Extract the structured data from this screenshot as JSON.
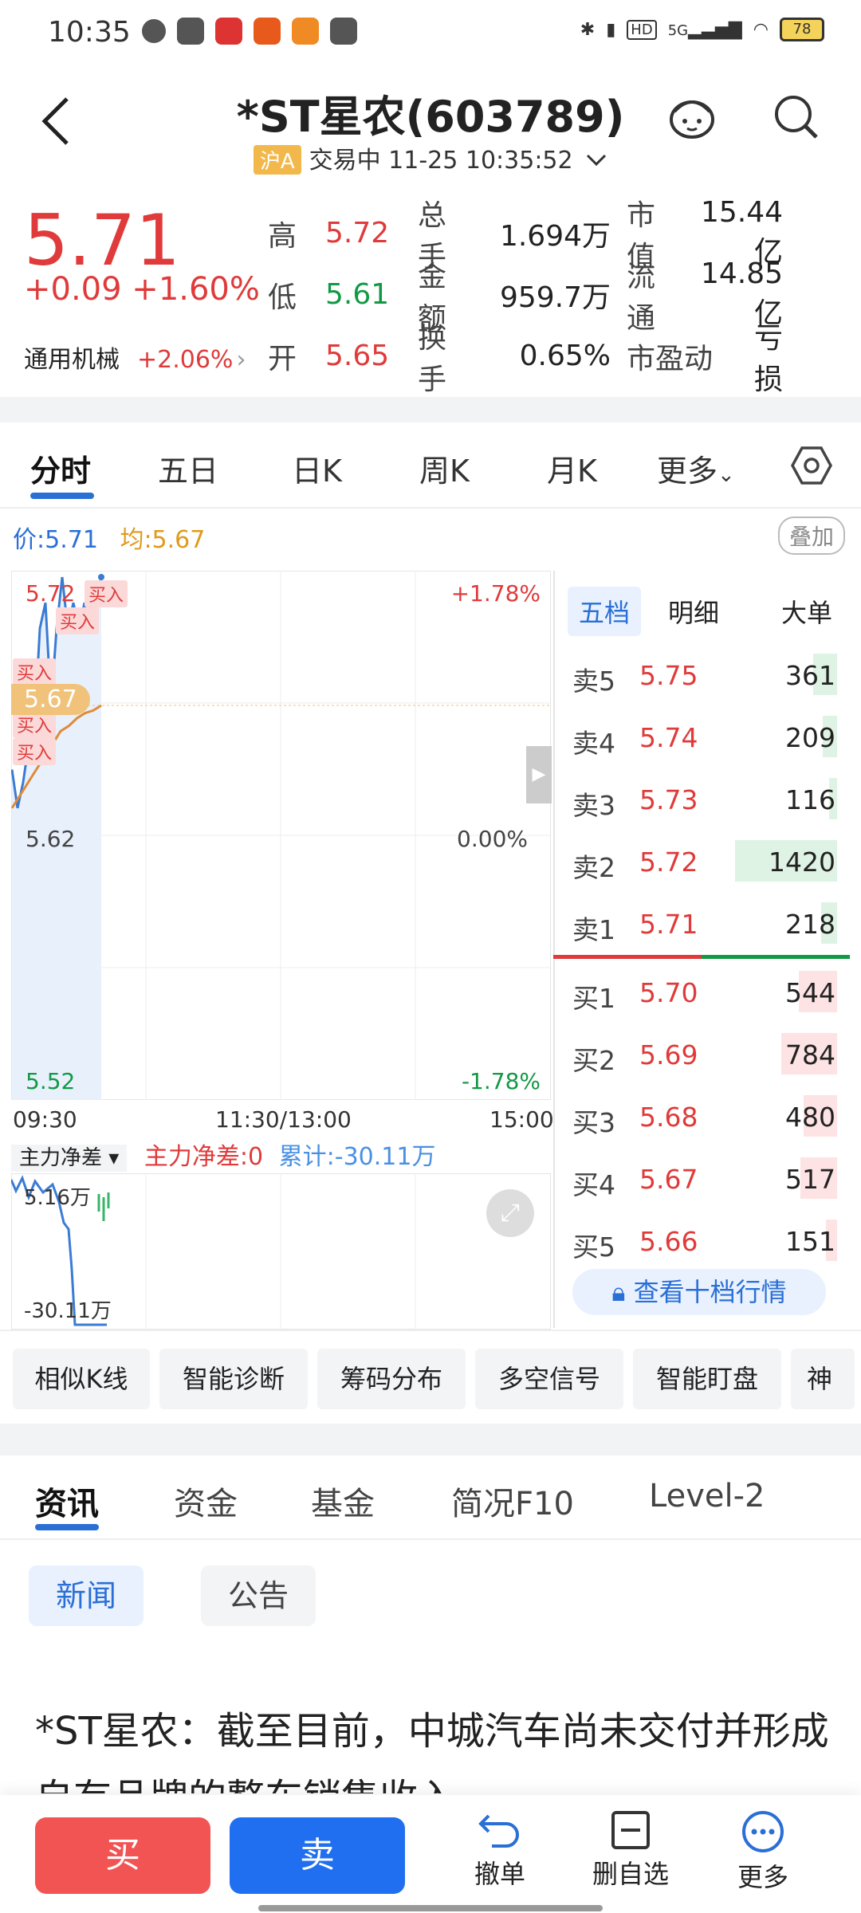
{
  "status_bar": {
    "time": "10:35",
    "network": "5G",
    "hd": "HD",
    "battery": "78"
  },
  "header": {
    "title": "*ST星农(603789)",
    "market_badge": "沪A",
    "trade_status": "交易中 11-25 10:35:52"
  },
  "quote": {
    "price": "5.71",
    "change": "+0.09",
    "change_pct": "+1.60%",
    "sector": "通用机械",
    "sector_pct": "+2.06%",
    "rows": [
      [
        {
          "label": "高",
          "value": "5.72"
        },
        {
          "label": "总手",
          "value": "1.694万"
        },
        {
          "label": "市值",
          "value": "15.44亿"
        }
      ],
      [
        {
          "label": "低",
          "value": "5.61"
        },
        {
          "label": "金额",
          "value": "959.7万"
        },
        {
          "label": "流通",
          "value": "14.85亿"
        }
      ],
      [
        {
          "label": "开",
          "value": "5.65"
        },
        {
          "label": "换手",
          "value": "0.65%"
        },
        {
          "label": "市盈动",
          "value": "亏损"
        }
      ]
    ]
  },
  "chart_tabs": [
    "分时",
    "五日",
    "日K",
    "周K",
    "月K",
    "更多"
  ],
  "intraday": {
    "price_label": "价:5.71",
    "avg_label": "均:5.67",
    "overlay": "叠加",
    "y_top": "5.72",
    "y_mid": "5.62",
    "y_bottom": "5.52",
    "pct_top": "+1.78%",
    "pct_mid": "0.00%",
    "pct_bottom": "-1.78%",
    "avg_bubble": "5.67",
    "buy_tag": "买入",
    "time_start": "09:30",
    "time_mid": "11:30/13:00",
    "time_end": "15:00"
  },
  "chart_data": {
    "type": "line",
    "ylim": [
      5.52,
      5.72
    ],
    "series": [
      {
        "values": [
          5.645,
          5.63,
          5.64,
          5.655,
          5.66,
          5.7,
          5.71,
          5.67,
          5.7,
          5.72,
          5.7,
          5.71,
          5.7,
          5.71,
          5.7,
          5.71,
          5.72
        ]
      },
      {
        "values": [
          5.63,
          5.635,
          5.64,
          5.645,
          5.65,
          5.655,
          5.66,
          5.662,
          5.665,
          5.667,
          5.668,
          5.67
        ]
      }
    ]
  },
  "orderbook": {
    "tabs": [
      "五档",
      "明细",
      "大单"
    ],
    "asks": [
      {
        "label": "卖5",
        "price": "5.75",
        "vol": "361"
      },
      {
        "label": "卖4",
        "price": "5.74",
        "vol": "209"
      },
      {
        "label": "卖3",
        "price": "5.73",
        "vol": "116"
      },
      {
        "label": "卖2",
        "price": "5.72",
        "vol": "1420"
      },
      {
        "label": "卖1",
        "price": "5.71",
        "vol": "218"
      }
    ],
    "bids": [
      {
        "label": "买1",
        "price": "5.70",
        "vol": "544"
      },
      {
        "label": "买2",
        "price": "5.69",
        "vol": "784"
      },
      {
        "label": "买3",
        "price": "5.68",
        "vol": "480"
      },
      {
        "label": "买4",
        "price": "5.67",
        "vol": "517"
      },
      {
        "label": "买5",
        "price": "5.66",
        "vol": "151"
      }
    ],
    "ten_level_btn": "查看十档行情"
  },
  "flow": {
    "selector": "主力净差",
    "net": "主力净差:0",
    "cumulative": "累计:-30.11万",
    "top": "5.16万",
    "bottom": "-30.11万"
  },
  "features": [
    "相似K线",
    "智能诊断",
    "筹码分布",
    "多空信号",
    "智能盯盘",
    "神"
  ],
  "news_tabs": [
    "资讯",
    "资金",
    "基金",
    "简况F10",
    "Level-2"
  ],
  "news_subtabs": [
    "新闻",
    "公告"
  ],
  "headline": "*ST星农：截至目前，中城汽车尚未交付并形成自有品牌的整车销售收入",
  "bottom": {
    "buy": "买",
    "sell": "卖",
    "cancel": "撤单",
    "remove": "删自选",
    "more": "更多"
  }
}
